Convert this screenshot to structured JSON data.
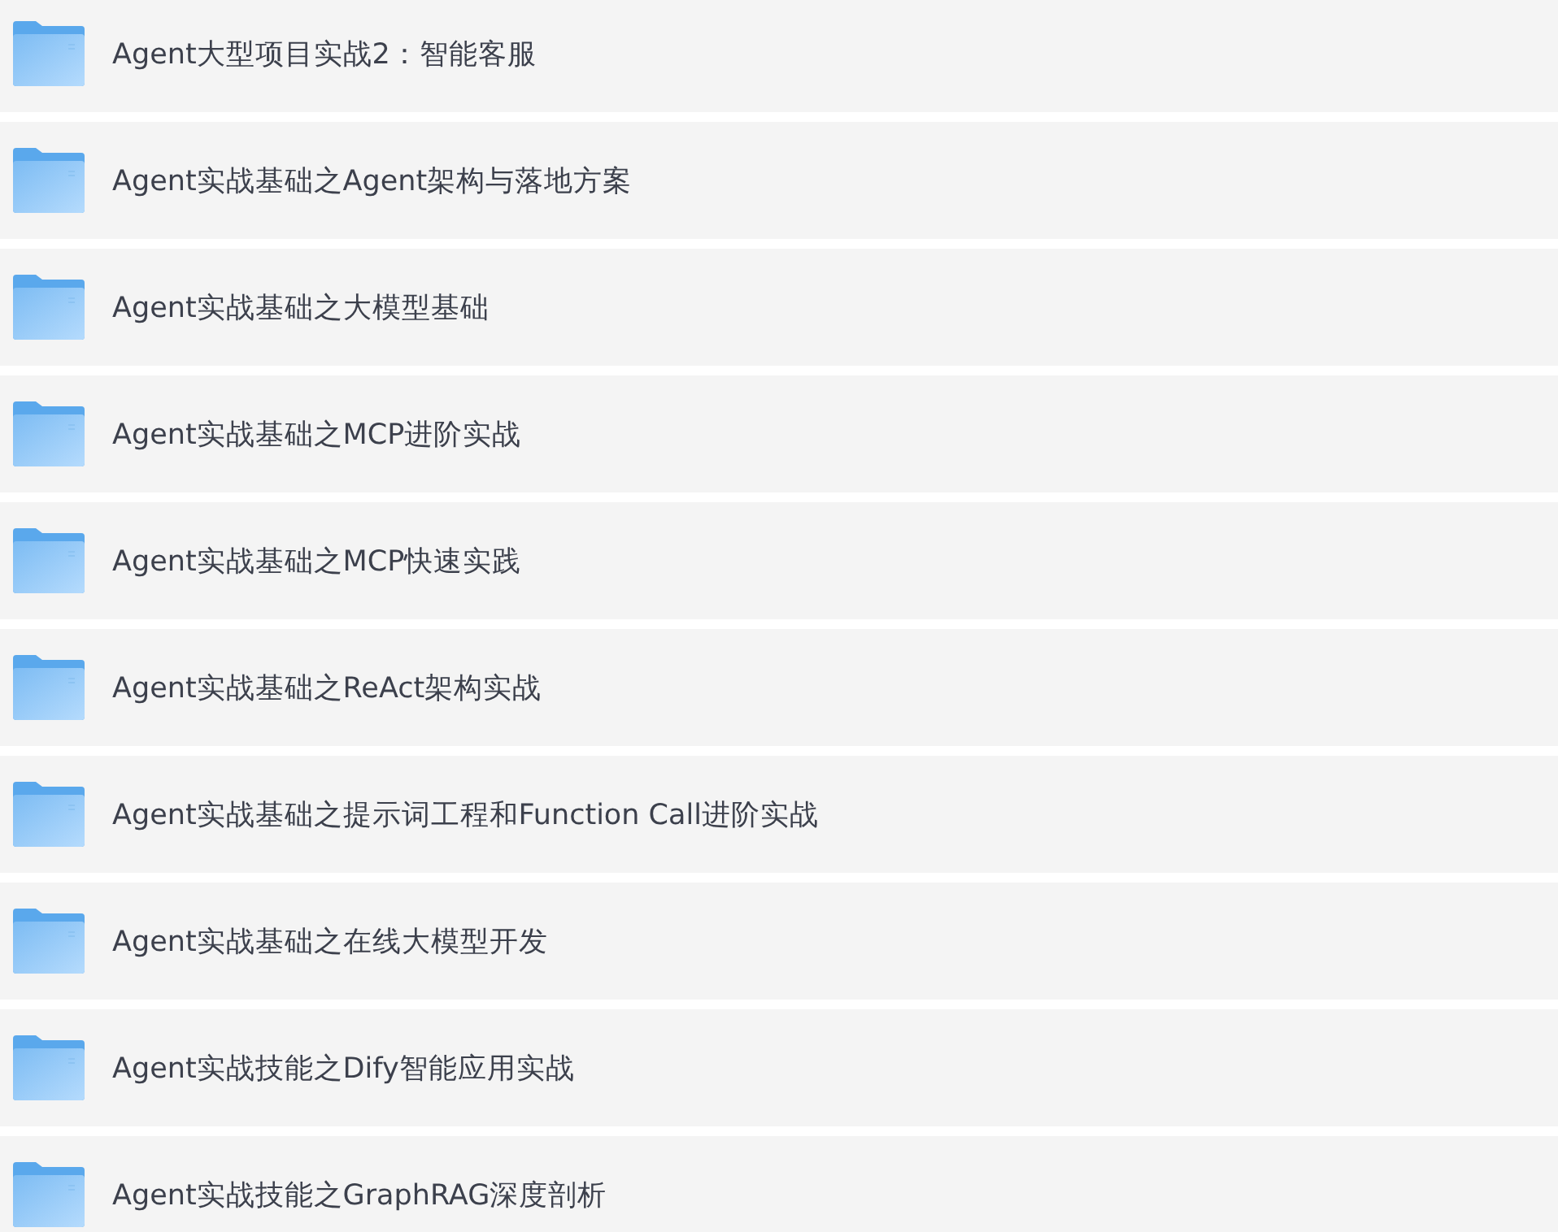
{
  "folders": [
    {
      "name": "Agent大型项目实战2：智能客服"
    },
    {
      "name": "Agent实战基础之Agent架构与落地方案"
    },
    {
      "name": "Agent实战基础之大模型基础"
    },
    {
      "name": "Agent实战基础之MCP进阶实战"
    },
    {
      "name": "Agent实战基础之MCP快速实践"
    },
    {
      "name": "Agent实战基础之ReAct架构实战"
    },
    {
      "name": "Agent实战基础之提示词工程和Function Call进阶实战"
    },
    {
      "name": "Agent实战基础之在线大模型开发"
    },
    {
      "name": "Agent实战技能之Dify智能应用实战"
    },
    {
      "name": "Agent实战技能之GraphRAG深度剖析"
    }
  ]
}
